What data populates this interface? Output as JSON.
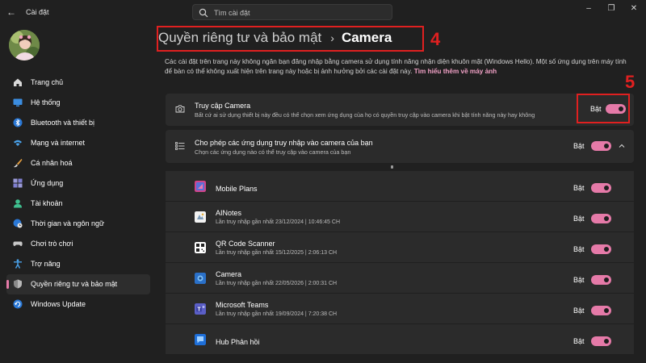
{
  "window": {
    "title": "Cài đặt",
    "search_placeholder": "Tìm cài đặt",
    "controls": [
      "minimize-icon",
      "maximize-icon",
      "close-icon"
    ]
  },
  "sidebar": {
    "items": [
      {
        "label": "Trang chủ",
        "icon": "home-icon",
        "active": false
      },
      {
        "label": "Hệ thống",
        "icon": "system-icon",
        "active": false
      },
      {
        "label": "Bluetooth và thiết bị",
        "icon": "bluetooth-icon",
        "active": false
      },
      {
        "label": "Mạng và internet",
        "icon": "wifi-icon",
        "active": false
      },
      {
        "label": "Cá nhân hoá",
        "icon": "brush-icon",
        "active": false
      },
      {
        "label": "Ứng dụng",
        "icon": "apps-icon",
        "active": false
      },
      {
        "label": "Tài khoản",
        "icon": "account-icon",
        "active": false
      },
      {
        "label": "Thời gian và ngôn ngữ",
        "icon": "globe-clock-icon",
        "active": false
      },
      {
        "label": "Chơi trò chơi",
        "icon": "gamepad-icon",
        "active": false
      },
      {
        "label": "Trợ năng",
        "icon": "accessibility-icon",
        "active": false
      },
      {
        "label": "Quyền riêng tư và bảo mật",
        "icon": "shield-icon",
        "active": true
      },
      {
        "label": "Windows Update",
        "icon": "update-icon",
        "active": false
      }
    ]
  },
  "header": {
    "breadcrumb_parent": "Quyền riêng tư và bảo mật",
    "breadcrumb_sep": "›",
    "breadcrumb_current": "Camera",
    "annotation_4": "4",
    "annotation_5": "5"
  },
  "description": {
    "text": "Các cài đặt trên trang này không ngăn bạn đăng nhập bằng camera sử dụng tính năng nhận diện khuôn mặt (Windows Hello). Một số ứng dụng trên máy tính để bàn có thể không xuất hiện trên trang này hoặc bị ảnh hưởng bởi các cài đặt này.",
    "link": "Tìm hiểu thêm về máy ảnh"
  },
  "camera_access": {
    "title": "Truy cập Camera",
    "subtitle": "Bất cứ ai sử dụng thiết bị này đều có thể chọn xem ứng dụng của họ có quyền truy cập vào camera khi bật tính năng này hay không",
    "state": "Bật",
    "on": true
  },
  "app_access": {
    "title": "Cho phép các ứng dụng truy nhập vào camera của bạn",
    "subtitle": "Chọn các ứng dụng nào có thể truy cập vào camera của bạn",
    "state": "Bật",
    "on": true,
    "expanded": true
  },
  "apps": [
    {
      "name": "Mobile Plans",
      "access": "",
      "state": "Bật",
      "on": true,
      "icon": "mobile-plans-icon",
      "color": "#d0458a"
    },
    {
      "name": "AINotes",
      "access": "Lần truy nhập gần nhất 23/12/2024  |  10:46:45 CH",
      "state": "Bật",
      "on": true,
      "icon": "ainotes-icon",
      "color": "#f2f2f2"
    },
    {
      "name": "QR Code Scanner",
      "access": "Lần truy nhập gần nhất 15/12/2025  |  2:06:13 CH",
      "state": "Bật",
      "on": true,
      "icon": "qr-code-icon",
      "color": "#ffffff"
    },
    {
      "name": "Camera",
      "access": "Lần truy nhập gần nhất 22/05/2026  |  2:00:31 CH",
      "state": "Bật",
      "on": true,
      "icon": "camera-app-icon",
      "color": "#2a70c8"
    },
    {
      "name": "Microsoft Teams",
      "access": "Lần truy nhập gần nhất 19/09/2024  |  7:20:38 CH",
      "state": "Bật",
      "on": true,
      "icon": "teams-icon",
      "color": "#5b5fc7"
    },
    {
      "name": "Hub Phản hồi",
      "access": "",
      "state": "Bật",
      "on": true,
      "icon": "feedback-hub-icon",
      "color": "#1e6fd9"
    }
  ],
  "colors": {
    "accent": "#e57aa8",
    "background": "#202020",
    "card": "#2b2b2b",
    "annotation": "#e02020",
    "link": "#f0a0c5"
  }
}
